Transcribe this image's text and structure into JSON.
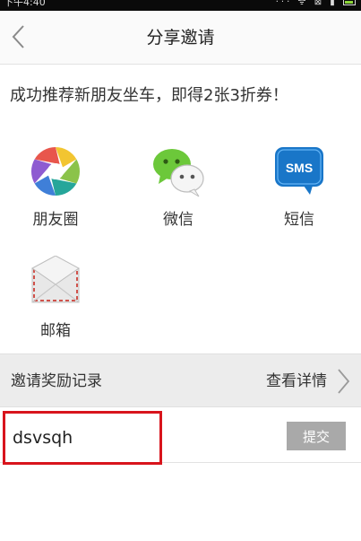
{
  "status_bar": {
    "time": "下午4:40",
    "icons": "··· ᯤ ⊠ ▮"
  },
  "header": {
    "title": "分享邀请"
  },
  "promo_text": "成功推荐新朋友坐车，即得2张3折券！",
  "share_options": [
    {
      "label": "朋友圈",
      "icon": "moments-icon"
    },
    {
      "label": "微信",
      "icon": "wechat-icon"
    },
    {
      "label": "短信",
      "icon": "sms-icon",
      "icon_text": "SMS"
    },
    {
      "label": "邮箱",
      "icon": "mail-icon"
    }
  ],
  "rewards": {
    "label": "邀请奖励记录",
    "details_label": "查看详情"
  },
  "invite_code": {
    "value": "dsvsqh",
    "submit_label": "提交"
  },
  "colors": {
    "highlight_border": "#d8141c",
    "sms_blue": "#1976c8",
    "wechat_green": "#6cc83a",
    "submit_gray": "#a9a9a9"
  }
}
